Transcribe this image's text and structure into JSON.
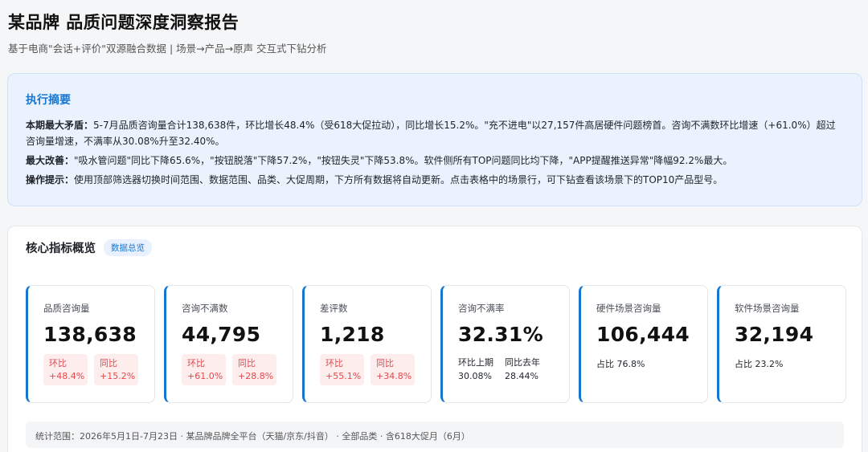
{
  "header": {
    "title": "某品牌 品质问题深度洞察报告",
    "subtitle": "基于电商\"会话+评价\"双源融合数据 | 场景→产品→原声 交互式下钻分析"
  },
  "summary": {
    "title": "执行摘要",
    "items": [
      {
        "label": "本期最大矛盾：",
        "text": "5-7月品质咨询量合计138,638件，环比增长48.4%（受618大促拉动），同比增长15.2%。\"充不进电\"以27,157件高居硬件问题榜首。咨询不满数环比增速（+61.0%）超过咨询量增速，不满率从30.08%升至32.40%。"
      },
      {
        "label": "最大改善：",
        "text": "\"吸水管问题\"同比下降65.6%，\"按钮脱落\"下降57.2%，\"按钮失灵\"下降53.8%。软件侧所有TOP问题同比均下降，\"APP提醒推送异常\"降幅92.2%最大。"
      },
      {
        "label": "操作提示：",
        "text": "使用顶部筛选器切换时间范围、数据范围、品类、大促周期，下方所有数据将自动更新。点击表格中的场景行，可下钻查看该场景下的TOP10产品型号。"
      }
    ]
  },
  "kpi": {
    "title": "核心指标概览",
    "badge": "数据总览",
    "cards": [
      {
        "label": "品质咨询量",
        "value": "138,638",
        "mom_label": "环比",
        "mom": "+48.4%",
        "yoy_label": "同比",
        "yoy": "+15.2%"
      },
      {
        "label": "咨询不满数",
        "value": "44,795",
        "mom_label": "环比",
        "mom": "+61.0%",
        "yoy_label": "同比",
        "yoy": "+28.8%"
      },
      {
        "label": "差评数",
        "value": "1,218",
        "mom_label": "环比",
        "mom": "+55.1%",
        "yoy_label": "同比",
        "yoy": "+34.8%"
      },
      {
        "label": "咨询不满率",
        "value": "32.31%",
        "prev_label": "环比上期",
        "prev": "30.08%",
        "last_label": "同比去年",
        "last": "28.44%"
      },
      {
        "label": "硬件场景咨询量",
        "value": "106,444",
        "share": "占比 76.8%"
      },
      {
        "label": "软件场景咨询量",
        "value": "32,194",
        "share": "占比 23.2%"
      }
    ],
    "footnote": "统计范围：2026年5月1日-7月23日 · 某品牌品牌全平台（天猫/京东/抖音） · 全部品类 · 含618大促月（6月）"
  }
}
